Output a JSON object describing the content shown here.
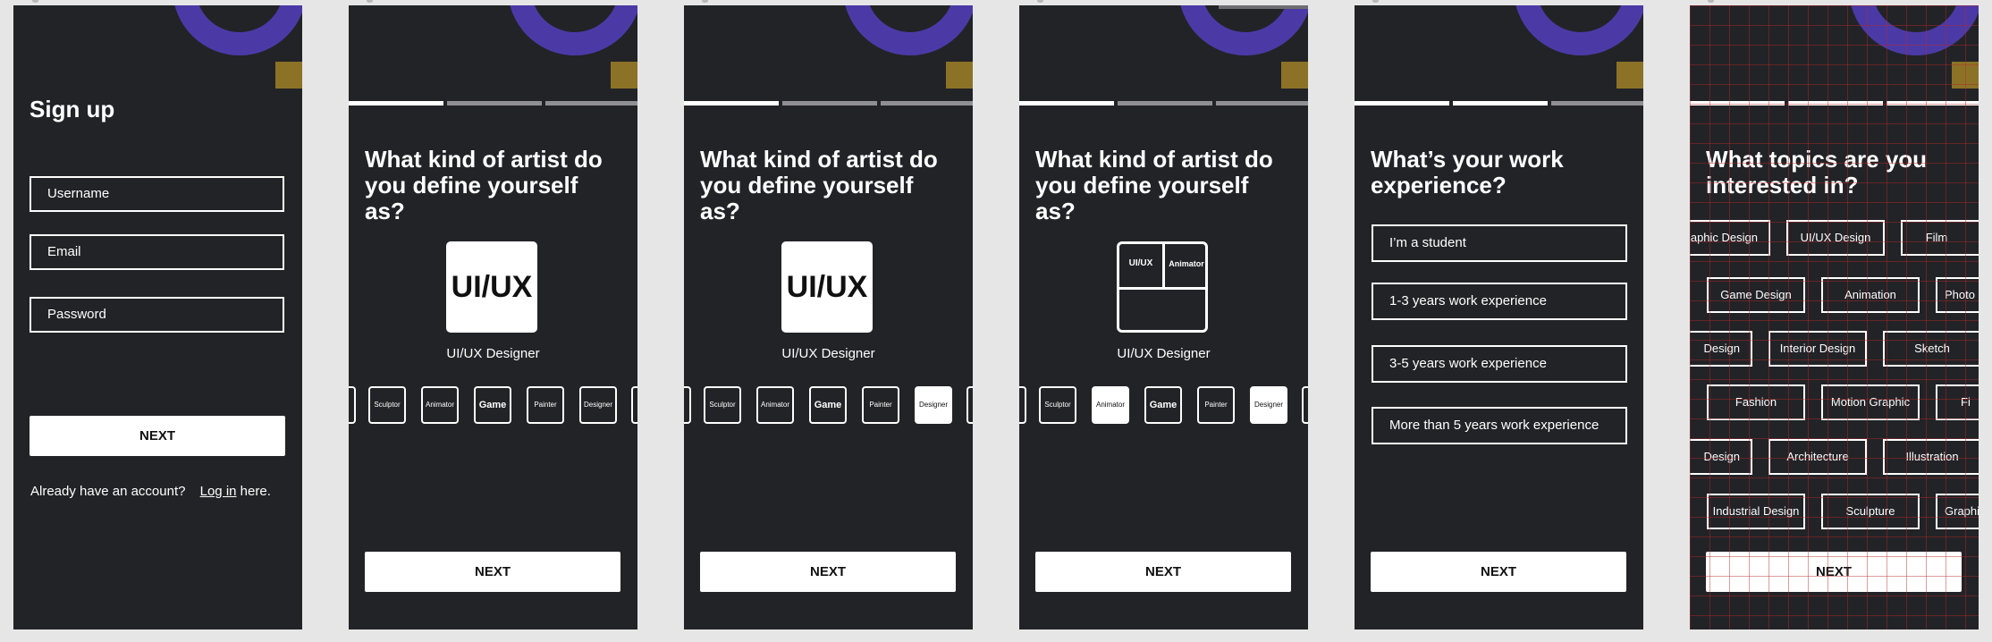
{
  "signup": {
    "title": "Sign up",
    "username": "Username",
    "email": "Email",
    "password": "Password",
    "next": "NEXT",
    "account_prompt": "Already have an account?",
    "login_link": "Log in",
    "login_suffix": "here."
  },
  "artist": {
    "title": "What kind of artist do you define yourself as?",
    "tile_label": "UI/UX",
    "caption": "UI/UX Designer",
    "chips": [
      "Sculptor",
      "Animator",
      "Game",
      "Painter",
      "Designer"
    ],
    "next": "NEXT"
  },
  "artist_multi": {
    "title": "What kind of artist do you define yourself as?",
    "tile_left": "UI/UX",
    "tile_right": "Animator",
    "caption": "UI/UX Designer",
    "next": "NEXT"
  },
  "experience": {
    "title": "What’s your work experience?",
    "options": [
      "I’m a student",
      "1-3 years work experience",
      "3-5 years work experience",
      "More than 5 years work experience"
    ],
    "next": "NEXT"
  },
  "topics": {
    "title": "What topics are you interested in?",
    "rows": [
      [
        "aphic Design",
        "UI/UX Design",
        "Film"
      ],
      [
        "Game Design",
        "Animation",
        "Photo"
      ],
      [
        "Design",
        "Interior Design",
        "Sketch"
      ],
      [
        "Fashion",
        "Motion Graphic",
        "Fi"
      ],
      [
        "Design",
        "Architecture",
        "Illustration"
      ],
      [
        "Industrial Design",
        "Sculpture",
        "Graphi"
      ]
    ],
    "next": "NEXT"
  },
  "colors": {
    "canvas": "#e6e6e6",
    "frame": "#222327",
    "accent_purple": "#4b3aa6",
    "accent_gold": "#8c7226",
    "text": "#ffffff"
  }
}
